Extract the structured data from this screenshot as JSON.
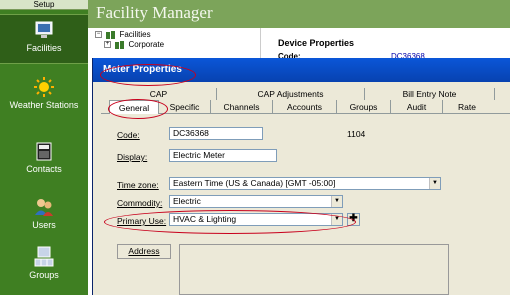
{
  "sidebar": {
    "setup_label": "Setup",
    "items": [
      {
        "label": "Facilities",
        "icon": "facilities-icon"
      },
      {
        "label": "Weather Stations",
        "icon": "sun-icon"
      },
      {
        "label": "Contacts",
        "icon": "contacts-book-icon"
      },
      {
        "label": "Users",
        "icon": "users-icon"
      },
      {
        "label": "Groups",
        "icon": "groups-icon"
      }
    ]
  },
  "header": {
    "title": "Facility Manager"
  },
  "tree": {
    "root": "Facilities",
    "child": "Corporate"
  },
  "device_properties": {
    "title": "Device Properties",
    "code_label": "Code:",
    "code_value": "DC36368"
  },
  "dialog": {
    "title": "Meter Properties",
    "tabs_row1": [
      "CAP",
      "CAP Adjustments",
      "Bill Entry Note"
    ],
    "tabs_row2": [
      "General",
      "Specific",
      "Channels",
      "Accounts",
      "Groups",
      "Audit",
      "Rate"
    ],
    "active_tab": "General",
    "form": {
      "code_label": "Code:",
      "code_value": "DC36368",
      "code_number": "1104",
      "display_label": "Display:",
      "display_value": "Electric Meter",
      "timezone_label": "Time zone:",
      "timezone_value": "Eastern Time (US & Canada) [GMT -05:00]",
      "commodity_label": "Commodity:",
      "commodity_value": "Electric",
      "primary_use_label": "Primary Use:",
      "primary_use_value": "HVAC & Lighting",
      "address_button": "Address"
    }
  },
  "colors": {
    "sidebar_green": "#3f7f22",
    "header_green": "#7ca45a",
    "titlebar_blue": "#0a56d8",
    "highlight_red": "#c8001c"
  }
}
